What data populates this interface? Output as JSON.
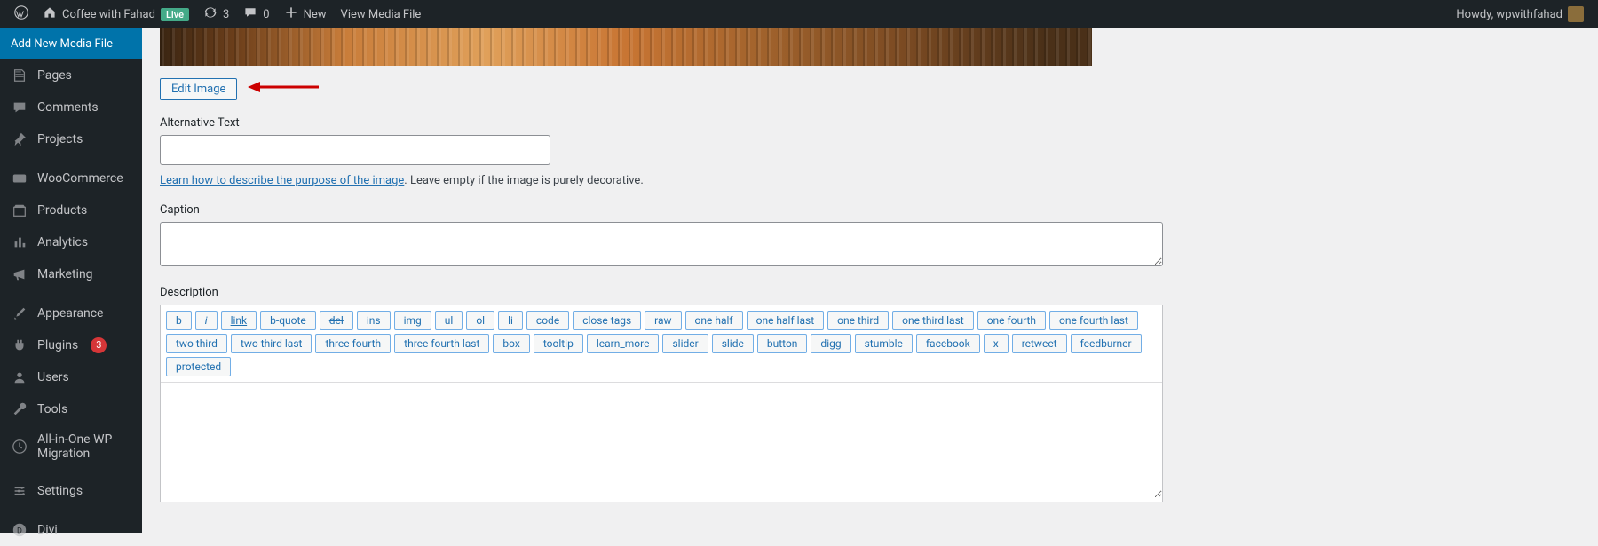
{
  "adminbar": {
    "site_name": "Coffee with Fahad",
    "live_badge": "Live",
    "updates_count": "3",
    "comments_count": "0",
    "new_label": "New",
    "view_media_label": "View Media File",
    "howdy": "Howdy, wpwithfahad"
  },
  "sidebar": {
    "current": "Add New Media File",
    "items": [
      {
        "label": "Pages",
        "icon": "pages"
      },
      {
        "label": "Comments",
        "icon": "comments"
      },
      {
        "label": "Projects",
        "icon": "projects"
      },
      {
        "label": "WooCommerce",
        "icon": "woo"
      },
      {
        "label": "Products",
        "icon": "products"
      },
      {
        "label": "Analytics",
        "icon": "analytics"
      },
      {
        "label": "Marketing",
        "icon": "marketing"
      },
      {
        "label": "Appearance",
        "icon": "appearance"
      },
      {
        "label": "Plugins",
        "icon": "plugins",
        "badge": "3"
      },
      {
        "label": "Users",
        "icon": "users"
      },
      {
        "label": "Tools",
        "icon": "tools"
      },
      {
        "label": "All-in-One WP Migration",
        "icon": "migration"
      },
      {
        "label": "Settings",
        "icon": "settings"
      },
      {
        "label": "Divi",
        "icon": "divi"
      }
    ]
  },
  "content": {
    "edit_image_btn": "Edit Image",
    "alt_label": "Alternative Text",
    "alt_value": "",
    "alt_link_text": "Learn how to describe the purpose of the image",
    "alt_hint_suffix": ". Leave empty if the image is purely decorative.",
    "caption_label": "Caption",
    "caption_value": "",
    "desc_label": "Description",
    "desc_value": "",
    "quicktags": [
      "b",
      "i",
      "link",
      "b-quote",
      "del",
      "ins",
      "img",
      "ul",
      "ol",
      "li",
      "code",
      "close tags",
      "raw",
      "one half",
      "one half last",
      "one third",
      "one third last",
      "one fourth",
      "one fourth last",
      "two third",
      "two third last",
      "three fourth",
      "three fourth last",
      "box",
      "tooltip",
      "learn_more",
      "slider",
      "slide",
      "button",
      "digg",
      "stumble",
      "facebook",
      "x",
      "retweet",
      "feedburner",
      "protected"
    ]
  }
}
